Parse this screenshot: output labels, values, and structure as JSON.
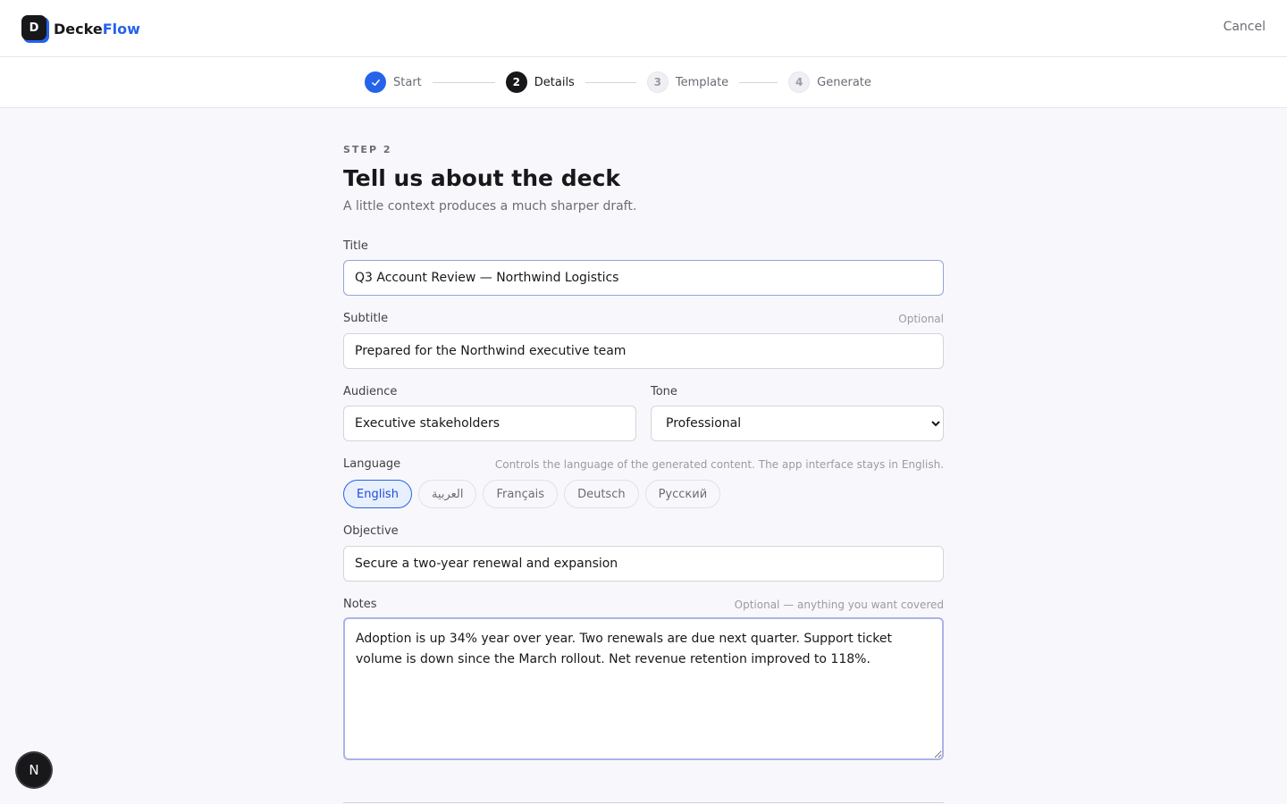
{
  "header": {
    "logo_letter": "D",
    "brand_part1": "Decke",
    "brand_part2": "Flow",
    "cancel_label": "Cancel"
  },
  "steps": [
    {
      "number": "✓",
      "label": "Start",
      "state": "done"
    },
    {
      "number": "2",
      "label": "Details",
      "state": "active"
    },
    {
      "number": "3",
      "label": "Template",
      "state": "todo"
    },
    {
      "number": "4",
      "label": "Generate",
      "state": "todo"
    }
  ],
  "page": {
    "eyebrow": "STEP 2",
    "title": "Tell us about the deck",
    "subtitle": "A little context produces a much sharper draft."
  },
  "form": {
    "title_label": "Title",
    "title_value": "Q3 Account Review — Northwind Logistics",
    "subtitle_label": "Subtitle",
    "subtitle_hint": "Optional",
    "subtitle_value": "Prepared for the Northwind executive team",
    "audience_label": "Audience",
    "audience_value": "Executive stakeholders",
    "tone_label": "Tone",
    "tone_value": "Professional",
    "language_label": "Language",
    "language_hint": "Controls the language of the generated content. The app interface stays in English.",
    "languages": [
      "English",
      "العربية",
      "Français",
      "Deutsch",
      "Русский"
    ],
    "language_selected": "English",
    "objective_label": "Objective",
    "objective_value": "Secure a two-year renewal and expansion",
    "notes_label": "Notes",
    "notes_hint": "Optional — anything you want covered",
    "notes_value": "Adoption is up 34% year over year. Two renewals are due next quarter. Support ticket volume is down since the March rollout. Net revenue retention improved to 118%."
  },
  "fab": {
    "icon": "N"
  },
  "colors": {
    "accent": "#2563eb",
    "dark": "#18181b"
  }
}
